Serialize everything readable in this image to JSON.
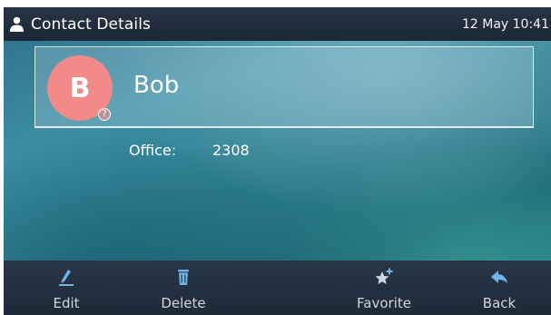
{
  "status_bar": {
    "title": "Contact Details",
    "datetime": "12 May 10:41",
    "icon": "user-icon"
  },
  "contact": {
    "avatar_initial": "B",
    "avatar_color": "#f18a89",
    "help_badge": "?",
    "name": "Bob",
    "fields": [
      {
        "label": "Office:",
        "value": "2308"
      }
    ]
  },
  "softkeys": [
    {
      "label": "Edit",
      "icon": "pencil-icon"
    },
    {
      "label": "Delete",
      "icon": "trash-icon"
    },
    {
      "label": "Favorite",
      "icon": "star-plus-icon"
    },
    {
      "label": "Back",
      "icon": "back-arrow-icon"
    }
  ],
  "colors": {
    "accent_icon": "#6fb4ea",
    "bar_background": "#1d2836"
  }
}
